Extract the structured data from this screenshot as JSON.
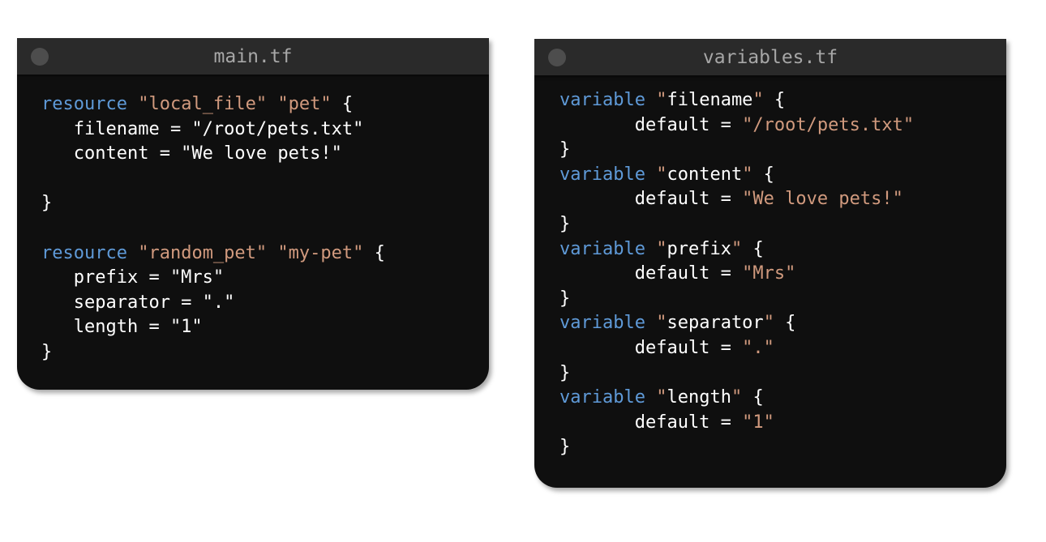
{
  "windows": [
    {
      "title": "main.tf",
      "lines": [
        [
          {
            "t": "kw",
            "v": "resource"
          },
          {
            "t": "plain",
            "v": " "
          },
          {
            "t": "str",
            "v": "\"local_file\""
          },
          {
            "t": "plain",
            "v": " "
          },
          {
            "t": "str",
            "v": "\"pet\""
          },
          {
            "t": "plain",
            "v": " {"
          }
        ],
        [
          {
            "t": "plain",
            "v": "   filename = \"/root/pets.txt\""
          }
        ],
        [
          {
            "t": "plain",
            "v": "   content = \"We love pets!\""
          }
        ],
        [],
        [
          {
            "t": "plain",
            "v": "}"
          }
        ],
        [],
        [
          {
            "t": "kw",
            "v": "resource"
          },
          {
            "t": "plain",
            "v": " "
          },
          {
            "t": "str",
            "v": "\"random_pet\""
          },
          {
            "t": "plain",
            "v": " "
          },
          {
            "t": "str",
            "v": "\"my-pet\""
          },
          {
            "t": "plain",
            "v": " {"
          }
        ],
        [
          {
            "t": "plain",
            "v": "   prefix = \"Mrs\""
          }
        ],
        [
          {
            "t": "plain",
            "v": "   separator = \".\""
          }
        ],
        [
          {
            "t": "plain",
            "v": "   length = \"1\""
          }
        ],
        [
          {
            "t": "plain",
            "v": "}"
          }
        ]
      ]
    },
    {
      "title": "variables.tf",
      "lines": [
        [
          {
            "t": "kw",
            "v": "variable"
          },
          {
            "t": "plain",
            "v": " "
          },
          {
            "t": "str",
            "v": "\""
          },
          {
            "t": "plain",
            "v": "filename"
          },
          {
            "t": "str",
            "v": "\""
          },
          {
            "t": "plain",
            "v": " {"
          }
        ],
        [
          {
            "t": "plain",
            "v": "       default = "
          },
          {
            "t": "str",
            "v": "\"/root/pets.txt\""
          }
        ],
        [
          {
            "t": "plain",
            "v": "}"
          }
        ],
        [
          {
            "t": "kw",
            "v": "variable"
          },
          {
            "t": "plain",
            "v": " "
          },
          {
            "t": "str",
            "v": "\""
          },
          {
            "t": "plain",
            "v": "content"
          },
          {
            "t": "str",
            "v": "\""
          },
          {
            "t": "plain",
            "v": " {"
          }
        ],
        [
          {
            "t": "plain",
            "v": "       default = "
          },
          {
            "t": "str",
            "v": "\"We love pets!\""
          }
        ],
        [
          {
            "t": "plain",
            "v": "}"
          }
        ],
        [
          {
            "t": "kw",
            "v": "variable"
          },
          {
            "t": "plain",
            "v": " "
          },
          {
            "t": "str",
            "v": "\""
          },
          {
            "t": "plain",
            "v": "prefix"
          },
          {
            "t": "str",
            "v": "\""
          },
          {
            "t": "plain",
            "v": " {"
          }
        ],
        [
          {
            "t": "plain",
            "v": "       default = "
          },
          {
            "t": "str",
            "v": "\"Mrs\""
          }
        ],
        [
          {
            "t": "plain",
            "v": "}"
          }
        ],
        [
          {
            "t": "kw",
            "v": "variable"
          },
          {
            "t": "plain",
            "v": " "
          },
          {
            "t": "str",
            "v": "\""
          },
          {
            "t": "plain",
            "v": "separator"
          },
          {
            "t": "str",
            "v": "\""
          },
          {
            "t": "plain",
            "v": " {"
          }
        ],
        [
          {
            "t": "plain",
            "v": "       default = "
          },
          {
            "t": "str",
            "v": "\".\""
          }
        ],
        [
          {
            "t": "plain",
            "v": "}"
          }
        ],
        [
          {
            "t": "kw",
            "v": "variable"
          },
          {
            "t": "plain",
            "v": " "
          },
          {
            "t": "str",
            "v": "\""
          },
          {
            "t": "plain",
            "v": "length"
          },
          {
            "t": "str",
            "v": "\""
          },
          {
            "t": "plain",
            "v": " {"
          }
        ],
        [
          {
            "t": "plain",
            "v": "       default = "
          },
          {
            "t": "str",
            "v": "\"1\""
          }
        ],
        [
          {
            "t": "plain",
            "v": "}"
          }
        ]
      ]
    }
  ],
  "colors": {
    "keyword": "#5f9ad8",
    "string": "#d19a7e",
    "text": "#ffffff",
    "background": "#0f0f0f",
    "titlebar": "#2a2a2a",
    "title_text": "#a7a7a7"
  }
}
